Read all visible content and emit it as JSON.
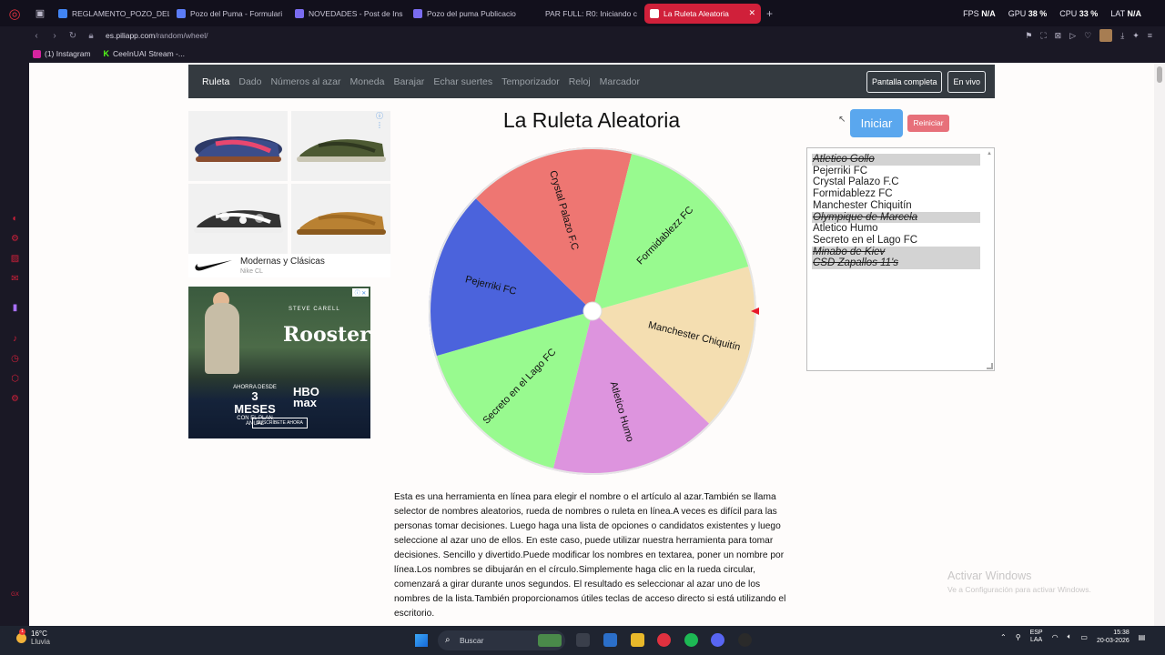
{
  "browser": {
    "tabs": [
      {
        "label": "REGLAMENTO_POZO_DEL",
        "favicon_color": "#4285f4"
      },
      {
        "label": "Pozo del Puma - Formulari",
        "favicon_color": "#5b7cf7"
      },
      {
        "label": "NOVEDADES - Post de Ins",
        "favicon_color": "#7a6cf0"
      },
      {
        "label": "Pozo del puma Publicacio",
        "favicon_color": "#7a6cf0"
      },
      {
        "label": "PAR FULL: R0: Iniciando c",
        "favicon_color": "#12101c"
      },
      {
        "label": "La Ruleta Aleatoria",
        "favicon_color": "#ffffff",
        "active": true
      }
    ],
    "new_tab": "+",
    "stats": [
      {
        "label": "FPS",
        "value": "N/A"
      },
      {
        "label": "GPU",
        "value": "38 %"
      },
      {
        "label": "CPU",
        "value": "33 %"
      },
      {
        "label": "LAT",
        "value": "N/A"
      }
    ],
    "url_host": "es.piliapp.com",
    "url_path": "/random/wheel/",
    "bookmarks": [
      "(1) Instagram",
      "CeeInUAI Stream -..."
    ]
  },
  "site": {
    "nav": [
      "Ruleta",
      "Dado",
      "Números al azar",
      "Moneda",
      "Barajar",
      "Echar suertes",
      "Temporizador",
      "Reloj",
      "Marcador"
    ],
    "active_nav": "Ruleta",
    "fullscreen_label": "Pantalla completa",
    "live_label": "En vivo",
    "title": "La Ruleta Aleatoria",
    "start_label": "Iniciar",
    "reset_label": "Reiniciar"
  },
  "ads": {
    "nike_title": "Modernas y Clásicas",
    "nike_sub": "Nike CL",
    "hbo_actor": "STEVE CARELL",
    "hbo_title": "Rooster",
    "hbo_offer_line1": "AHORRA DESDE",
    "hbo_offer_big": "3 MESES",
    "hbo_offer_line2": "CON EL PLAN ANUAL",
    "hbo_brand_1": "HBO",
    "hbo_brand_2": "max",
    "hbo_cta": "SUSCRÍBETE AHORA"
  },
  "wheel": {
    "colors": {
      "red": "#ee7672",
      "green": "#98fa8f",
      "tan": "#f4deb1",
      "purple": "#dd94de",
      "blue": "#4b63dc"
    },
    "segments": [
      {
        "label": "Manchester Chiquitín",
        "color": "#f4deb1"
      },
      {
        "label": "Atletico Humo",
        "color": "#dd94de"
      },
      {
        "label": "Secreto en el Lago FC",
        "color": "#98fa8f"
      },
      {
        "label": "Pejerriki FC",
        "color": "#4b63dc"
      },
      {
        "label": "Crystal Palazo F.C",
        "color": "#ee7672"
      },
      {
        "label": "Formidablezz FC",
        "color": "#98fa8f"
      }
    ],
    "pointer_color": "#e8182a"
  },
  "entries": [
    {
      "name": "Atletico Gollo",
      "struck": true
    },
    {
      "name": "Pejerriki FC",
      "struck": false
    },
    {
      "name": "Crystal Palazo F.C",
      "struck": false
    },
    {
      "name": "Formidablezz FC",
      "struck": false
    },
    {
      "name": "Manchester Chiquitín",
      "struck": false
    },
    {
      "name": "Olympique de Marcela",
      "struck": true
    },
    {
      "name": "Atletico Humo",
      "struck": false
    },
    {
      "name": "Secreto en el Lago FC",
      "struck": false
    },
    {
      "name": "Minabo de Kiev",
      "struck": true
    },
    {
      "name": "CSD Zapallos 11's",
      "struck": true
    }
  ],
  "description": "Esta es una herramienta en línea para elegir el nombre o el artículo al azar.También se llama selector de nombres aleatorios, rueda de nombres o ruleta en línea.A veces es difícil para las personas tomar decisiones. Luego haga una lista de opciones o candidatos existentes y luego seleccione al azar uno de ellos. En este caso, puede utilizar nuestra herramienta para tomar decisiones. Sencillo y divertido.Puede modificar los nombres en textarea, poner un nombre por línea.Los nombres se dibujarán en el círculo.Simplemente haga clic en la rueda circular, comenzará a girar durante unos segundos. El resultado es seleccionar al azar uno de los nombres de la lista.También proporcionamos útiles teclas de acceso directo si está utilizando el escritorio.",
  "watermark": {
    "title": "Activar Windows",
    "subtitle": "Ve a Configuración para activar Windows."
  },
  "taskbar": {
    "temperature": "16°C",
    "weather": "Lluvia",
    "search_placeholder": "Buscar",
    "lang_1": "ESP",
    "lang_2": "LAA",
    "time": "15:38",
    "date": "20-03-2026"
  }
}
